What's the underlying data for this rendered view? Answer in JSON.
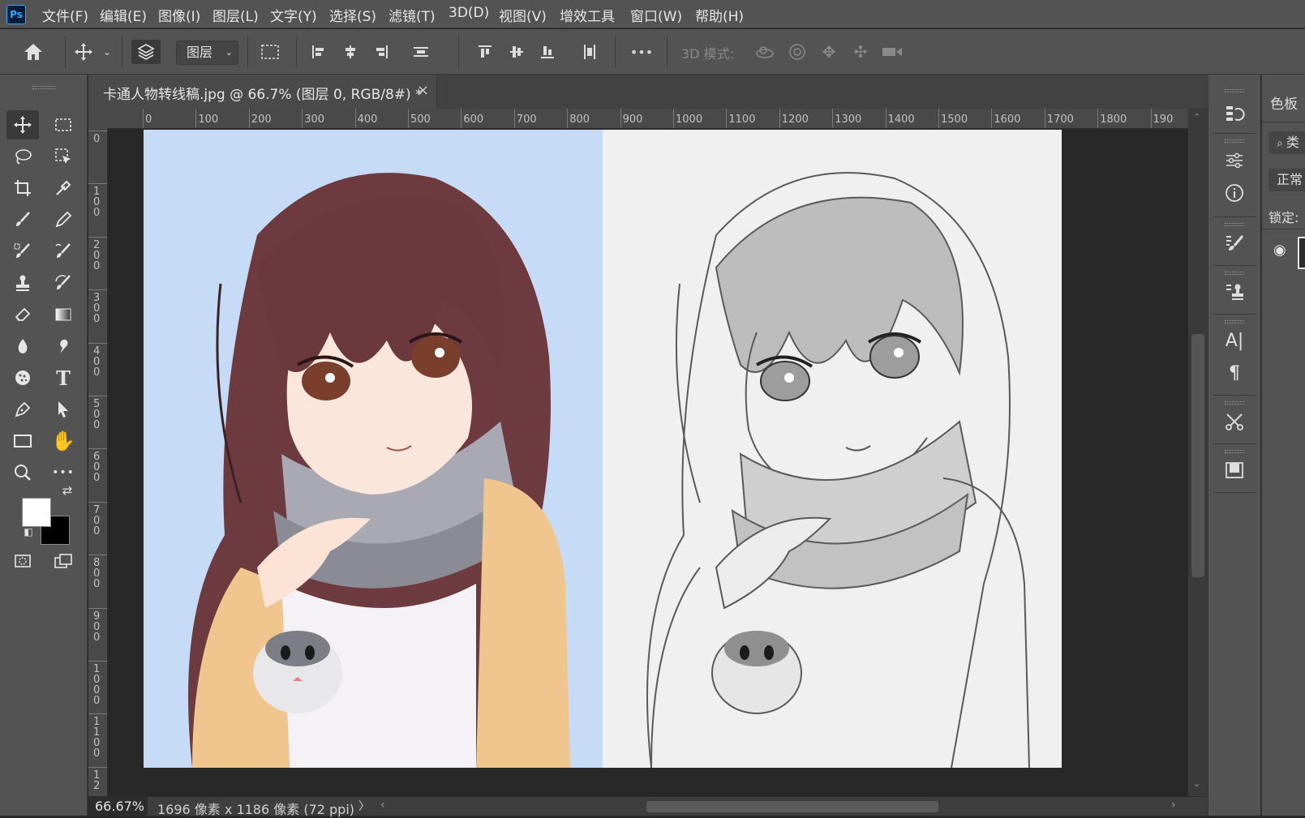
{
  "app": {
    "logo": "Ps",
    "accent": "#31a8ff"
  },
  "menu": [
    "文件(F)",
    "编辑(E)",
    "图像(I)",
    "图层(L)",
    "文字(Y)",
    "选择(S)",
    "滤镜(T)",
    "3D(D)",
    "视图(V)",
    "增效工具",
    "窗口(W)",
    "帮助(H)"
  ],
  "options": {
    "layer_select": "图层",
    "mode_3d_label": "3D 模式:",
    "more": "•••"
  },
  "document": {
    "title": "卡通人物转线稿.jpg @ 66.7% (图层 0, RGB/8#) *",
    "close": "×"
  },
  "rulers": {
    "horizontal": [
      "0",
      "100",
      "200",
      "300",
      "400",
      "500",
      "600",
      "700",
      "800",
      "900",
      "1000",
      "1100",
      "1200",
      "1300",
      "1400",
      "1500",
      "1600",
      "1700",
      "1800",
      "190"
    ],
    "vertical": [
      "0",
      "100",
      "200",
      "300",
      "400",
      "500",
      "600",
      "700",
      "800",
      "900",
      "1000",
      "1100",
      "12"
    ]
  },
  "colors": {
    "foreground": "#ffffff",
    "background": "#000000",
    "color_bg": "#c6dcf6",
    "sketch_bg": "#f0f0f0"
  },
  "status": {
    "zoom": "66.67%",
    "info": "1696 像素 x 1186 像素 (72 ppi)",
    "arrow": "〉"
  },
  "right_panel": {
    "tab": "色板",
    "filter": "类",
    "blend_mode": "正常",
    "lock_label": "锁定:"
  },
  "tools": [
    "move-tool",
    "marquee-tool",
    "lasso-tool",
    "object-select-tool",
    "crop-tool",
    "eyedropper-tool",
    "brush-tool",
    "pencil-tool",
    "healing-brush-tool",
    "mixer-brush-tool",
    "clone-stamp-tool",
    "history-brush-tool",
    "eraser-tool",
    "gradient-tool",
    "blur-tool",
    "smudge-tool",
    "sponge-tool",
    "type-tool",
    "pen-tool",
    "path-select-tool",
    "rectangle-tool",
    "hand-tool",
    "zoom-tool",
    "more-tools"
  ]
}
